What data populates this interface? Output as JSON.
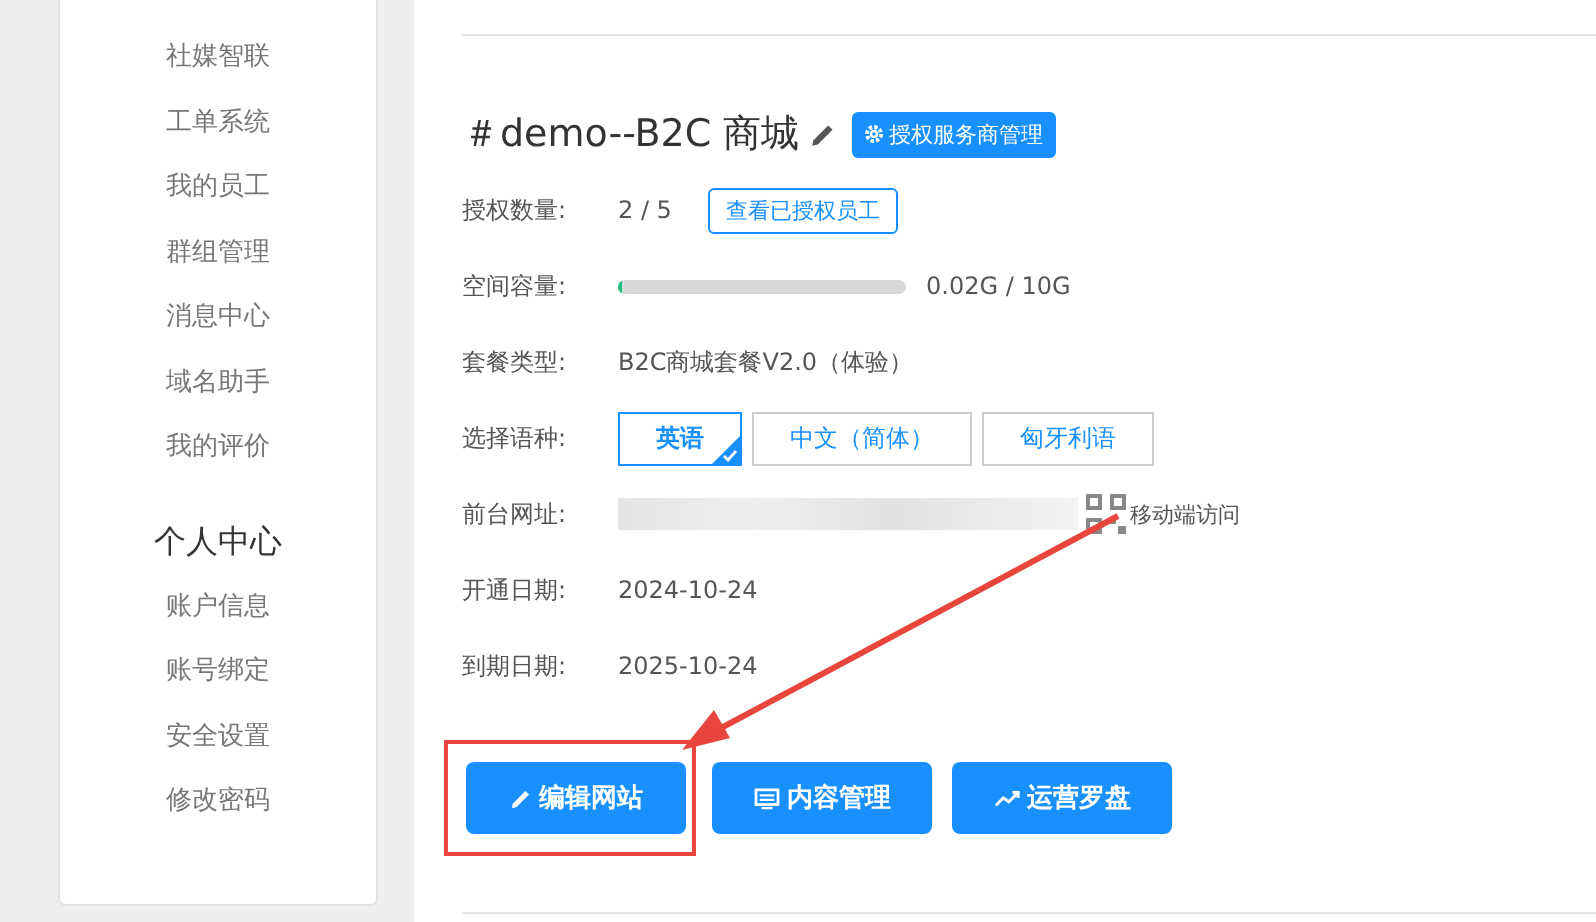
{
  "sidebar": {
    "items": [
      {
        "label": "社媒智联"
      },
      {
        "label": "工单系统"
      },
      {
        "label": "我的员工"
      },
      {
        "label": "群组管理"
      },
      {
        "label": "消息中心"
      },
      {
        "label": "域名助手"
      },
      {
        "label": "我的评价"
      }
    ],
    "section": {
      "title": "个人中心",
      "items": [
        {
          "label": "账户信息"
        },
        {
          "label": "账号绑定"
        },
        {
          "label": "安全设置"
        },
        {
          "label": "修改密码"
        }
      ]
    }
  },
  "site": {
    "title": "＃demo--B2C 商城",
    "manage_button": "授权服务商管理",
    "license": {
      "label": "授权数量:",
      "value": "2 / 5",
      "button": "查看已授权员工"
    },
    "storage": {
      "label": "空间容量:",
      "level": 0.01,
      "reading": "0.02G / 10G"
    },
    "plan": {
      "label": "套餐类型:",
      "value": "B2C商城套餐V2.0（体验）"
    },
    "language": {
      "label": "选择语种:",
      "options": [
        {
          "label": "英语",
          "selected": true
        },
        {
          "label": "中文（简体）",
          "selected": false
        },
        {
          "label": "匈牙利语",
          "selected": false
        }
      ]
    },
    "url": {
      "label": "前台网址:",
      "mobile_link": "移动端访问"
    },
    "opened": {
      "label": "开通日期:",
      "value": "2024-10-24"
    },
    "expires": {
      "label": "到期日期:",
      "value": "2025-10-24"
    },
    "actions": [
      {
        "kind": "edit",
        "label": "编辑网站",
        "highlighted": true
      },
      {
        "kind": "content",
        "label": "内容管理",
        "highlighted": false
      },
      {
        "kind": "stats",
        "label": "运营罗盘",
        "highlighted": false
      }
    ]
  }
}
